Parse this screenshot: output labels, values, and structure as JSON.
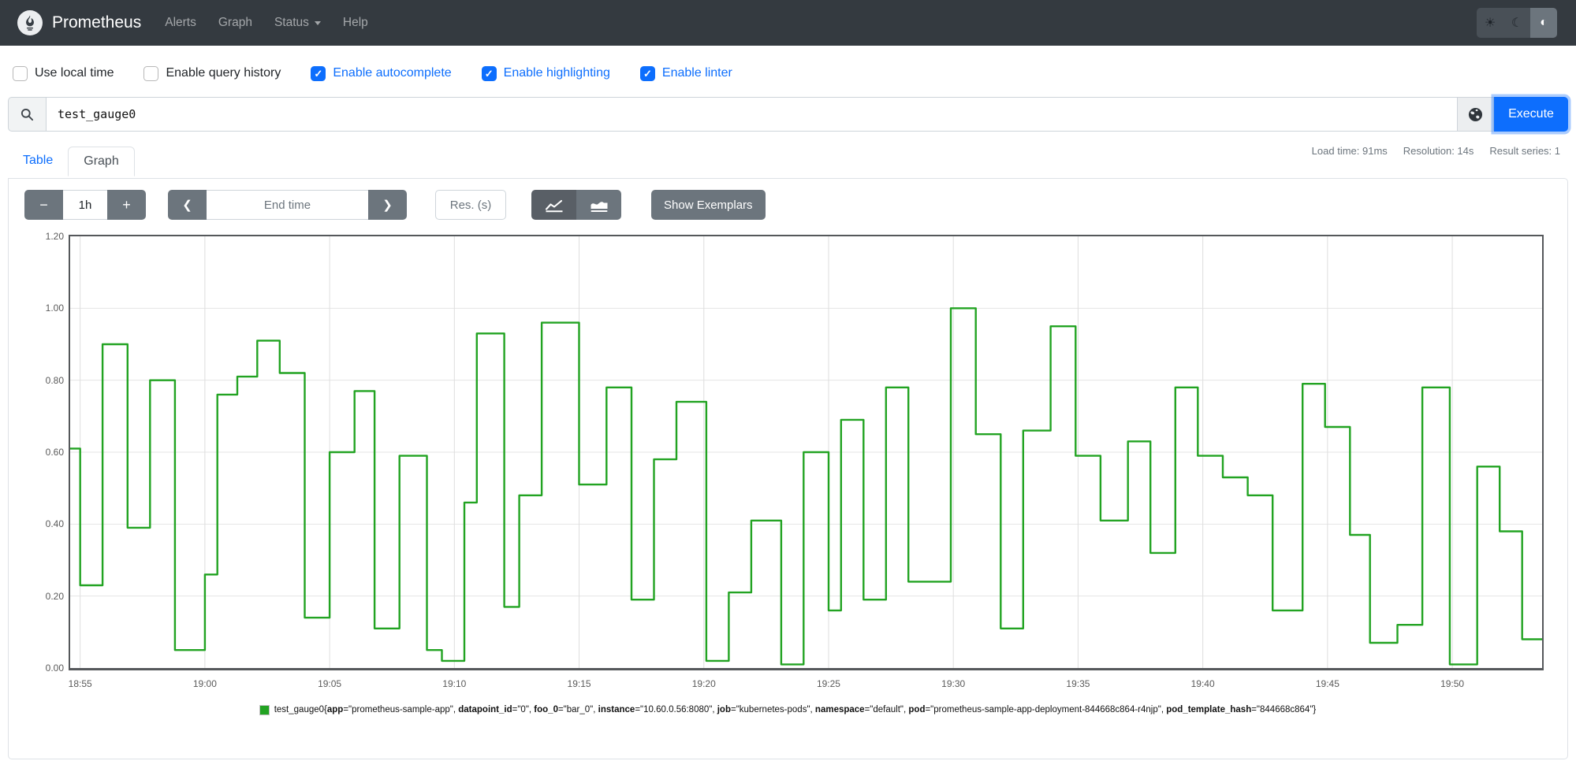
{
  "navbar": {
    "brand": "Prometheus",
    "items": [
      {
        "label": "Alerts"
      },
      {
        "label": "Graph"
      },
      {
        "label": "Status"
      },
      {
        "label": "Help"
      }
    ],
    "theme": [
      {
        "name": "light",
        "glyph": "☀"
      },
      {
        "name": "dark",
        "glyph": "☾"
      },
      {
        "name": "auto",
        "glyph": "◐"
      }
    ]
  },
  "options": [
    {
      "label": "Use local time",
      "checked": false
    },
    {
      "label": "Enable query history",
      "checked": false
    },
    {
      "label": "Enable autocomplete",
      "checked": true
    },
    {
      "label": "Enable highlighting",
      "checked": true
    },
    {
      "label": "Enable linter",
      "checked": true
    }
  ],
  "query": {
    "value": "test_gauge0",
    "execute_label": "Execute"
  },
  "stats": {
    "load_time": "Load time: 91ms",
    "resolution": "Resolution: 14s",
    "result_series": "Result series: 1"
  },
  "tabs": {
    "table": "Table",
    "graph": "Graph"
  },
  "graph_controls": {
    "minus": "−",
    "range": "1h",
    "plus": "+",
    "prev": "❮",
    "end_time_placeholder": "End time",
    "next": "❯",
    "res_placeholder": "Res. (s)",
    "show_exemplars": "Show Exemplars"
  },
  "chart_data": {
    "type": "line",
    "style": "step-after",
    "title": "",
    "xlabel": "",
    "ylabel": "",
    "ylim": [
      0,
      1.2
    ],
    "grid": true,
    "legend_position": "bottom",
    "t_end": 59,
    "x_ticks": [
      {
        "label": "18:55",
        "t": 0.4
      },
      {
        "label": "19:00",
        "t": 5.4
      },
      {
        "label": "19:05",
        "t": 10.4
      },
      {
        "label": "19:10",
        "t": 15.4
      },
      {
        "label": "19:15",
        "t": 20.4
      },
      {
        "label": "19:20",
        "t": 25.4
      },
      {
        "label": "19:25",
        "t": 30.4
      },
      {
        "label": "19:30",
        "t": 35.4
      },
      {
        "label": "19:35",
        "t": 40.4
      },
      {
        "label": "19:40",
        "t": 45.4
      },
      {
        "label": "19:45",
        "t": 50.4
      },
      {
        "label": "19:50",
        "t": 55.4
      }
    ],
    "y_ticks": [
      {
        "label": "0.00",
        "v": 0.0
      },
      {
        "label": "0.20",
        "v": 0.2
      },
      {
        "label": "0.40",
        "v": 0.4
      },
      {
        "label": "0.60",
        "v": 0.6
      },
      {
        "label": "0.80",
        "v": 0.8
      },
      {
        "label": "1.00",
        "v": 1.0
      },
      {
        "label": "1.20",
        "v": 1.2
      }
    ],
    "series": [
      {
        "name": "test_gauge0",
        "color": "#22a322",
        "points": [
          [
            0.0,
            0.61
          ],
          [
            0.4,
            0.23
          ],
          [
            1.3,
            0.9
          ],
          [
            2.3,
            0.39
          ],
          [
            3.2,
            0.8
          ],
          [
            4.2,
            0.05
          ],
          [
            5.4,
            0.26
          ],
          [
            5.9,
            0.76
          ],
          [
            6.7,
            0.81
          ],
          [
            7.5,
            0.91
          ],
          [
            8.4,
            0.82
          ],
          [
            9.4,
            0.14
          ],
          [
            10.4,
            0.6
          ],
          [
            11.4,
            0.77
          ],
          [
            12.2,
            0.11
          ],
          [
            13.2,
            0.59
          ],
          [
            14.3,
            0.05
          ],
          [
            14.9,
            0.02
          ],
          [
            15.8,
            0.46
          ],
          [
            16.3,
            0.93
          ],
          [
            17.4,
            0.17
          ],
          [
            18.0,
            0.48
          ],
          [
            18.9,
            0.96
          ],
          [
            20.4,
            0.51
          ],
          [
            21.5,
            0.78
          ],
          [
            22.5,
            0.19
          ],
          [
            23.4,
            0.58
          ],
          [
            24.3,
            0.74
          ],
          [
            25.5,
            0.02
          ],
          [
            26.4,
            0.21
          ],
          [
            27.3,
            0.41
          ],
          [
            28.5,
            0.01
          ],
          [
            29.4,
            0.6
          ],
          [
            30.4,
            0.16
          ],
          [
            30.9,
            0.69
          ],
          [
            31.8,
            0.19
          ],
          [
            32.7,
            0.78
          ],
          [
            33.6,
            0.24
          ],
          [
            35.3,
            1.0
          ],
          [
            36.3,
            0.65
          ],
          [
            37.3,
            0.11
          ],
          [
            38.2,
            0.66
          ],
          [
            39.3,
            0.95
          ],
          [
            40.3,
            0.59
          ],
          [
            41.3,
            0.41
          ],
          [
            42.4,
            0.63
          ],
          [
            43.3,
            0.32
          ],
          [
            44.3,
            0.78
          ],
          [
            45.2,
            0.59
          ],
          [
            46.2,
            0.53
          ],
          [
            47.2,
            0.48
          ],
          [
            48.2,
            0.16
          ],
          [
            49.4,
            0.79
          ],
          [
            50.3,
            0.67
          ],
          [
            51.3,
            0.37
          ],
          [
            52.1,
            0.07
          ],
          [
            53.2,
            0.12
          ],
          [
            54.2,
            0.78
          ],
          [
            55.3,
            0.01
          ],
          [
            56.4,
            0.56
          ],
          [
            57.3,
            0.38
          ],
          [
            58.2,
            0.08
          ]
        ]
      }
    ]
  },
  "legend": {
    "metric": "test_gauge0",
    "labels": [
      [
        "app",
        "prometheus-sample-app"
      ],
      [
        "datapoint_id",
        "0"
      ],
      [
        "foo_0",
        "bar_0"
      ],
      [
        "instance",
        "10.60.0.56:8080"
      ],
      [
        "job",
        "kubernetes-pods"
      ],
      [
        "namespace",
        "default"
      ],
      [
        "pod",
        "prometheus-sample-app-deployment-844668c864-r4njp"
      ],
      [
        "pod_template_hash",
        "844668c864"
      ]
    ]
  }
}
